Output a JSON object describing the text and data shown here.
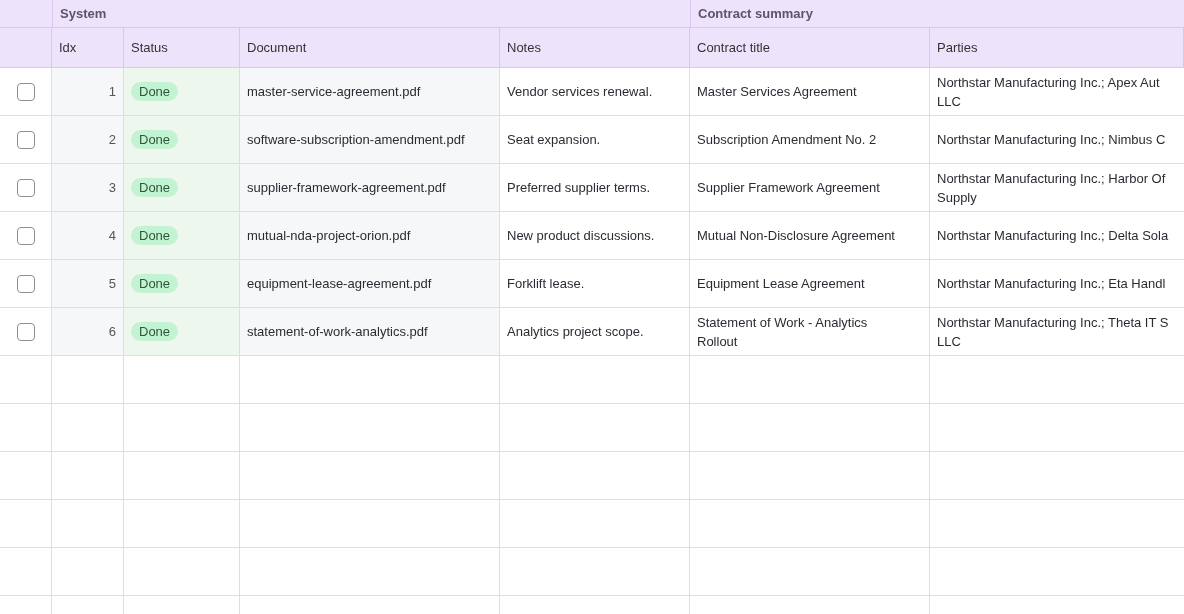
{
  "column_groups": [
    {
      "label": "System"
    },
    {
      "label": "Contract summary"
    }
  ],
  "columns": [
    "Idx",
    "Status",
    "Document",
    "Notes",
    "Contract title",
    "Parties"
  ],
  "rows": [
    {
      "checked": false,
      "idx": "1",
      "status": "Done",
      "document": "master-service-agreement.pdf",
      "notes": "Vendor services renewal.",
      "contract_title": "Master Services Agreement",
      "parties": "Northstar Manufacturing Inc.; Apex Aut\nLLC"
    },
    {
      "checked": false,
      "idx": "2",
      "status": "Done",
      "document": "software-subscription-amendment.pdf",
      "notes": "Seat expansion.",
      "contract_title": "Subscription Amendment No. 2",
      "parties": "Northstar Manufacturing Inc.; Nimbus C"
    },
    {
      "checked": false,
      "idx": "3",
      "status": "Done",
      "document": "supplier-framework-agreement.pdf",
      "notes": "Preferred supplier terms.",
      "contract_title": "Supplier Framework Agreement",
      "parties": "Northstar Manufacturing Inc.; Harbor Of\nSupply"
    },
    {
      "checked": false,
      "idx": "4",
      "status": "Done",
      "document": "mutual-nda-project-orion.pdf",
      "notes": "New product discussions.",
      "contract_title": "Mutual Non-Disclosure Agreement",
      "parties": "Northstar Manufacturing Inc.; Delta Sola"
    },
    {
      "checked": false,
      "idx": "5",
      "status": "Done",
      "document": "equipment-lease-agreement.pdf",
      "notes": "Forklift lease.",
      "contract_title": "Equipment Lease Agreement",
      "parties": "Northstar Manufacturing Inc.; Eta Handl"
    },
    {
      "checked": false,
      "idx": "6",
      "status": "Done",
      "document": "statement-of-work-analytics.pdf",
      "notes": "Analytics project scope.",
      "contract_title": "Statement of Work - Analytics\nRollout",
      "parties": "Northstar Manufacturing Inc.; Theta IT S\nLLC"
    }
  ]
}
